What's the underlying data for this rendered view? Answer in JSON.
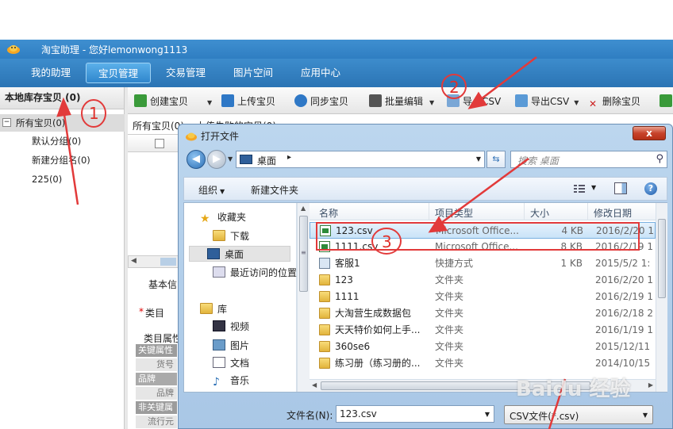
{
  "app": {
    "title": "淘宝助理 - 您好lemonwong1113",
    "nav_tabs": [
      {
        "label": "我的助理"
      },
      {
        "label": "宝贝管理"
      },
      {
        "label": "交易管理"
      },
      {
        "label": "图片空间"
      },
      {
        "label": "应用中心"
      }
    ],
    "active_tab": "宝贝管理"
  },
  "sidebar": {
    "header": "本地库存宝贝 (0)",
    "root": {
      "toggle": "−",
      "label": "所有宝贝(0)"
    },
    "children": [
      {
        "label": "默认分组(0)"
      },
      {
        "label": "新建分组名(0)"
      },
      {
        "label": "225(0)"
      }
    ]
  },
  "toolbar": {
    "create": "创建宝贝",
    "upload": "上传宝贝",
    "sync": "同步宝贝",
    "batch_edit": "批量编辑",
    "import_csv": "导入CSV",
    "export_csv": "导出CSV",
    "delete": "删除宝贝"
  },
  "content": {
    "subtab_all": "所有宝贝(0)",
    "subtab_failed": "上传失败的宝贝(0)",
    "basic_info": "基本信",
    "category_star": "*",
    "category": "类目",
    "category_attr": "类目属性",
    "key_attr": "关键属性",
    "attr_huohao": "货号",
    "attr_pinpai_head": "品牌",
    "attr_pinpai": "品牌",
    "non_key_attr": "非关键属",
    "attr_liuxing": "流行元"
  },
  "dialog": {
    "title": "打开文件",
    "close": "x",
    "address": "桌面",
    "address_sep": "▸",
    "search_placeholder": "搜索 桌面",
    "organize": "组织",
    "new_folder": "新建文件夹",
    "help": "?",
    "nav": {
      "favorites": "收藏夹",
      "downloads": "下载",
      "desktop": "桌面",
      "recent": "最近访问的位置",
      "libraries": "库",
      "videos": "视频",
      "pictures": "图片",
      "documents": "文档",
      "music": "音乐"
    },
    "columns": [
      "名称",
      "项目类型",
      "大小",
      "修改日期"
    ],
    "files": [
      {
        "name": "123.csv",
        "type": "Microsoft Office...",
        "size": "4 KB",
        "date": "2016/2/20 1",
        "icon": "csv-file-icon",
        "selected": true
      },
      {
        "name": "1111.csv",
        "type": "Microsoft Office...",
        "size": "8 KB",
        "date": "2016/2/19 1",
        "icon": "csv-file-icon"
      },
      {
        "name": "客服1",
        "type": "快捷方式",
        "size": "1 KB",
        "date": "2015/5/2 1:",
        "icon": "shortcut-icon"
      },
      {
        "name": "123",
        "type": "文件夹",
        "size": "",
        "date": "2016/2/20 1",
        "icon": "folder-icon"
      },
      {
        "name": "1111",
        "type": "文件夹",
        "size": "",
        "date": "2016/2/19 1",
        "icon": "folder-icon"
      },
      {
        "name": "大淘营生成数据包",
        "type": "文件夹",
        "size": "",
        "date": "2016/2/18 2",
        "icon": "folder-icon"
      },
      {
        "name": "天天特价如何上手...",
        "type": "文件夹",
        "size": "",
        "date": "2016/1/19 1",
        "icon": "folder-icon"
      },
      {
        "name": "360se6",
        "type": "文件夹",
        "size": "",
        "date": "2015/12/11",
        "icon": "folder-icon"
      },
      {
        "name": "练习册（练习册的...",
        "type": "文件夹",
        "size": "",
        "date": "2014/10/15",
        "icon": "folder-icon"
      }
    ],
    "filename_label": "文件名(N):",
    "filename_value": "123.csv",
    "filetype_value": "CSV文件(*.csv)"
  },
  "annotations": {
    "n1": "1",
    "n2": "2",
    "n3": "3",
    "color": "#e23a3a"
  },
  "watermark": "Baidu 经验",
  "colors": {
    "title_bar": "#2f7ec2",
    "accent": "#5bb0ea",
    "selection": "#c9e3f8"
  }
}
